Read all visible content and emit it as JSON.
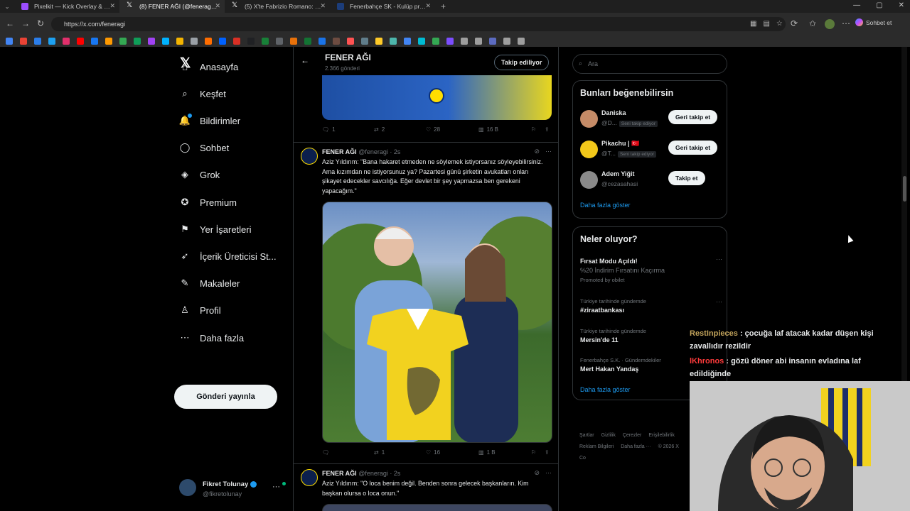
{
  "browser": {
    "tabs": [
      {
        "title": "Pixelkit — Kick Overlay & Bot",
        "color": "#9b4dff"
      },
      {
        "title": "(8) FENER AĞI (@feneragi) / X",
        "color": "#ffffff"
      },
      {
        "title": "(5) X'te Fabrizio Romano: \"🚨 Re",
        "color": "#ffffff"
      },
      {
        "title": "Fenerbahçe SK - Kulüp profili | Tra",
        "color": "#1c3d7a"
      }
    ],
    "url": "https://x.com/feneragi",
    "profile_button": "Sohbet et",
    "bookmark_colors": [
      "#4285f4",
      "#ea4335",
      "#2b7de9",
      "#1da1f2",
      "#e1306c",
      "#ff0000",
      "#1877f2",
      "#ff9900",
      "#34a853",
      "#0f9d58",
      "#a142f4",
      "#00b2ff",
      "#f4b400",
      "#9aa0a6",
      "#ff6d00",
      "#0061ff",
      "#d93025",
      "#202124",
      "#188038",
      "#5f6368",
      "#e8710a",
      "#137333",
      "#1a73e8",
      "#6d4c41",
      "#ff5252",
      "#607d8b",
      "#ffca28",
      "#4db6ac",
      "#4285f4",
      "#00bcd4",
      "#34a853",
      "#7c4dff",
      "#9e9e9e",
      "#9e9e9e",
      "#5c6bc0",
      "#9e9e9e",
      "#9e9e9e"
    ]
  },
  "nav": {
    "items": [
      {
        "label": "Anasayfa",
        "icon": "⌂",
        "name": "home"
      },
      {
        "label": "Keşfet",
        "icon": "⌕",
        "name": "explore"
      },
      {
        "label": "Bildirimler",
        "icon": "🔔",
        "name": "notifications"
      },
      {
        "label": "Sohbet",
        "icon": "◯",
        "name": "chat"
      },
      {
        "label": "Grok",
        "icon": "◈",
        "name": "grok"
      },
      {
        "label": "Premium",
        "icon": "✪",
        "name": "premium"
      },
      {
        "label": "Yer İşaretleri",
        "icon": "⚑",
        "name": "bookmarks"
      },
      {
        "label": "İçerik Üreticisi St...",
        "icon": "➶",
        "name": "creator-studio"
      },
      {
        "label": "Makaleler",
        "icon": "✎",
        "name": "articles"
      },
      {
        "label": "Profil",
        "icon": "♙",
        "name": "profile"
      },
      {
        "label": "Daha fazla",
        "icon": "⋯",
        "name": "more"
      }
    ],
    "post_button": "Gönderi yayınla",
    "account": {
      "name": "Fikret Tolunay",
      "handle": "@fikretolunay"
    }
  },
  "profile_header": {
    "name": "FENER AĞI",
    "post_count": "2.366 gönderi",
    "follow_button": "Takip ediliyor"
  },
  "tweet0": {
    "replies": "1",
    "reposts": "2",
    "likes": "28",
    "views": "16 B"
  },
  "tweets": [
    {
      "author": "FENER AĞI",
      "handle": "@feneragi",
      "time": "2s",
      "text": "Aziz Yıldırım: \"Bana hakaret etmeden ne söylemek istiyorsanız söyleyebilirsiniz. Ama kızımdan ne istiyorsunuz ya? Pazartesi günü şirketin avukatları onları şikayet edecekler savcılığa. Eğer devlet bir şey yapmazsa ben gerekeni yapacağım.\"",
      "replies": "",
      "reposts": "1",
      "likes": "16",
      "views": "1 B"
    },
    {
      "author": "FENER AĞI",
      "handle": "@feneragi",
      "time": "2s",
      "text": "Aziz Yıldırım: \"O loca benim değil. Benden sonra gelecek başkanların. Kim başkan olursa o loca onun.\""
    }
  ],
  "search": {
    "placeholder": "Ara"
  },
  "who_to_follow": {
    "title": "Bunları beğenebilirsin",
    "users": [
      {
        "name": "Daniska",
        "handle": "@D...",
        "badge": "Seni takip ediyor",
        "button": "Geri takip et",
        "color": "#c58b67"
      },
      {
        "name": "Pikachu | 🇹🇷",
        "handle": "@T...",
        "badge": "Seni takip ediyor",
        "button": "Geri takip et",
        "color": "#f2c81a"
      },
      {
        "name": "Adem Yiğit",
        "handle": "@cezasahasi",
        "badge": "",
        "button": "Takip et",
        "color": "#8a8a8a"
      }
    ],
    "more": "Daha fazla göster"
  },
  "trends": {
    "title": "Neler oluyor?",
    "items": [
      {
        "small": "",
        "title": "Fırsat Modu Açıldı!",
        "sub": "%20 İndirim Fırsatını Kaçırma",
        "promo": "Promoted by obilet"
      },
      {
        "small": "Türkiye tarihinde gündemde",
        "title": "#ziraatbankası",
        "sub": "",
        "promo": ""
      },
      {
        "small": "Türkiye tarihinde gündemde",
        "title": "Mersin'de 11",
        "sub": "",
        "promo": ""
      },
      {
        "small": "Fenerbahçe S.K. · Gündemdekiler",
        "title": "Mert Hakan Yandaş",
        "sub": "",
        "promo": ""
      }
    ],
    "more": "Daha fazla göster"
  },
  "footer": {
    "links": [
      "Şartlar",
      "Gizlilik",
      "Çerezler",
      "Erişilebilirlik",
      "Reklam Bilgileri",
      "Daha fazla ···",
      "© 2026 X Co"
    ]
  },
  "stream_chat": [
    {
      "user": "RestInpieces",
      "message": ": çocuğa laf atacak kadar düşen kişi zavallıdır rezildir",
      "color": "#c2a35b"
    },
    {
      "user": "lKhronos",
      "message": ": gözü döner abi insanın evladına laf edildiğinde",
      "color": "#ff3b3b"
    }
  ]
}
